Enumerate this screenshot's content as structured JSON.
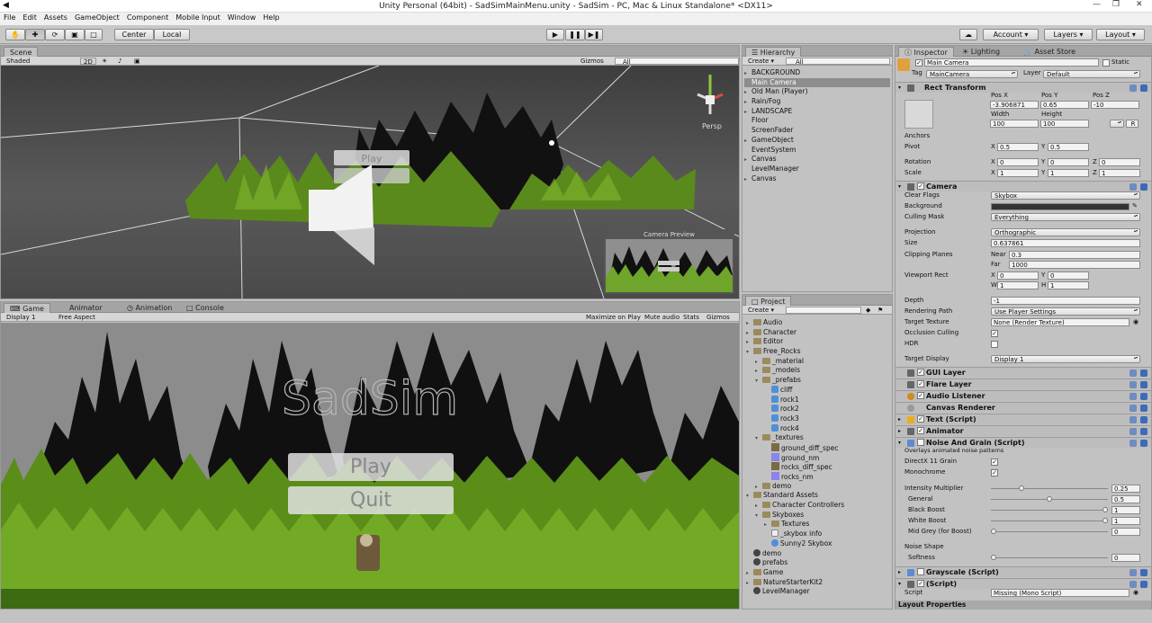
{
  "window": {
    "title": "Unity Personal (64bit) - SadSimMainMenu.unity - SadSim - PC, Mac & Linux Standalone* <DX11>"
  },
  "menu": [
    "File",
    "Edit",
    "Assets",
    "GameObject",
    "Component",
    "Mobile Input",
    "Window",
    "Help"
  ],
  "toolbar": {
    "pivot": "Center",
    "space": "Local",
    "cloud": "",
    "account": "Account",
    "layers": "Layers",
    "layout": "Layout"
  },
  "scene": {
    "tab": "Scene",
    "shading": "Shaded",
    "mode2d": "2D",
    "gizmos": "Gizmos",
    "search": "All",
    "persp": "Persp",
    "preview": "Camera Preview",
    "play_text": "Play"
  },
  "game": {
    "tabs": [
      "Game",
      "Animator",
      "Animation",
      "Console"
    ],
    "display": "Display 1",
    "aspect": "Free Aspect",
    "buttons": [
      "Maximize on Play",
      "Mute audio",
      "Stats",
      "Gizmos"
    ],
    "logo": "SadSim",
    "play": "Play",
    "quit": "Quit"
  },
  "hierarchy": {
    "tab": "Hierarchy",
    "create": "Create",
    "search": "All",
    "items": [
      {
        "label": "BACKGROUND",
        "arrow": true,
        "sel": false
      },
      {
        "label": "Main Camera",
        "arrow": false,
        "sel": true
      },
      {
        "label": "Old Man (Player)",
        "arrow": true,
        "sel": false
      },
      {
        "label": "Rain/Fog",
        "arrow": true,
        "sel": false
      },
      {
        "label": "LANDSCAPE",
        "arrow": true,
        "sel": false
      },
      {
        "label": "Floor",
        "arrow": false,
        "sel": false
      },
      {
        "label": "ScreenFader",
        "arrow": false,
        "sel": false
      },
      {
        "label": "GameObject",
        "arrow": true,
        "sel": false
      },
      {
        "label": "EventSystem",
        "arrow": false,
        "sel": false
      },
      {
        "label": "Canvas",
        "arrow": true,
        "sel": false
      },
      {
        "label": "LevelManager",
        "arrow": false,
        "sel": false
      },
      {
        "label": "Canvas",
        "arrow": true,
        "sel": false
      }
    ]
  },
  "project": {
    "tab": "Project",
    "create": "Create",
    "items": [
      {
        "label": "Audio",
        "indent": 0,
        "icon": "folder",
        "arrow": "▸"
      },
      {
        "label": "Character",
        "indent": 0,
        "icon": "folder",
        "arrow": "▸"
      },
      {
        "label": "Editor",
        "indent": 0,
        "icon": "folder",
        "arrow": "▸"
      },
      {
        "label": "Free_Rocks",
        "indent": 0,
        "icon": "folder",
        "arrow": "▾"
      },
      {
        "label": "_material",
        "indent": 1,
        "icon": "folder",
        "arrow": "▸"
      },
      {
        "label": "_models",
        "indent": 1,
        "icon": "folder",
        "arrow": "▸"
      },
      {
        "label": "_prefabs",
        "indent": 1,
        "icon": "folder",
        "arrow": "▾"
      },
      {
        "label": "cliff",
        "indent": 2,
        "icon": "cube",
        "arrow": ""
      },
      {
        "label": "rock1",
        "indent": 2,
        "icon": "cube",
        "arrow": ""
      },
      {
        "label": "rock2",
        "indent": 2,
        "icon": "cube",
        "arrow": ""
      },
      {
        "label": "rock3",
        "indent": 2,
        "icon": "cube",
        "arrow": ""
      },
      {
        "label": "rock4",
        "indent": 2,
        "icon": "cube",
        "arrow": ""
      },
      {
        "label": "_textures",
        "indent": 1,
        "icon": "folder",
        "arrow": "▾"
      },
      {
        "label": "ground_diff_spec",
        "indent": 2,
        "icon": "tex",
        "arrow": ""
      },
      {
        "label": "ground_nm",
        "indent": 2,
        "icon": "texb",
        "arrow": ""
      },
      {
        "label": "rocks_diff_spec",
        "indent": 2,
        "icon": "tex",
        "arrow": ""
      },
      {
        "label": "rocks_nm",
        "indent": 2,
        "icon": "texb",
        "arrow": ""
      },
      {
        "label": "demo",
        "indent": 1,
        "icon": "folder",
        "arrow": "▸"
      },
      {
        "label": "Standard Assets",
        "indent": 0,
        "icon": "folder",
        "arrow": "▾"
      },
      {
        "label": "Character Controllers",
        "indent": 1,
        "icon": "folder",
        "arrow": "▸"
      },
      {
        "label": "Skyboxes",
        "indent": 1,
        "icon": "folder",
        "arrow": "▾"
      },
      {
        "label": "Textures",
        "indent": 2,
        "icon": "folder",
        "arrow": "▸"
      },
      {
        "label": "_skybox info",
        "indent": 2,
        "icon": "doc",
        "arrow": ""
      },
      {
        "label": "Sunny2 Skybox",
        "indent": 2,
        "icon": "sphere",
        "arrow": ""
      },
      {
        "label": "demo",
        "indent": 0,
        "icon": "unity",
        "arrow": ""
      },
      {
        "label": "prefabs",
        "indent": 0,
        "icon": "unity",
        "arrow": ""
      },
      {
        "label": "Game",
        "indent": 0,
        "icon": "folder",
        "arrow": "▸"
      },
      {
        "label": "NatureStarterKit2",
        "indent": 0,
        "icon": "folder",
        "arrow": "▸"
      },
      {
        "label": "LevelManager",
        "indent": 0,
        "icon": "unity",
        "arrow": ""
      }
    ]
  },
  "inspector": {
    "tabs": [
      "Inspector",
      "Lighting",
      "Asset Store"
    ],
    "name": "Main Camera",
    "static": "Static",
    "tag_label": "Tag",
    "tag": "MainCamera",
    "layer_label": "Layer",
    "layer": "Default",
    "rect": {
      "title": "Rect Transform",
      "posx_l": "Pos X",
      "posy_l": "Pos Y",
      "posz_l": "Pos Z",
      "posx": "-3.906871",
      "posy": "0.65",
      "posz": "-10",
      "w_l": "Width",
      "h_l": "Height",
      "w": "100",
      "h": "100",
      "anchors": "Anchors",
      "pivot": "Pivot",
      "px": "0.5",
      "py": "0.5",
      "rotation": "Rotation",
      "rx": "0",
      "ry": "0",
      "rz": "0",
      "scale": "Scale",
      "sx": "1",
      "sy": "1",
      "sz": "1",
      "r": "R"
    },
    "camera": {
      "title": "Camera",
      "clear_l": "Clear Flags",
      "clear": "Skybox",
      "bg_l": "Background",
      "cull_l": "Culling Mask",
      "cull": "Everything",
      "proj_l": "Projection",
      "proj": "Orthographic",
      "size_l": "Size",
      "size": "0.637861",
      "clip_l": "Clipping Planes",
      "near_l": "Near",
      "near": "0.3",
      "far_l": "Far",
      "far": "1000",
      "vp_l": "Viewport Rect",
      "vx": "0",
      "vy": "0",
      "vw": "1",
      "vh": "1",
      "depth_l": "Depth",
      "depth": "-1",
      "rp_l": "Rendering Path",
      "rp": "Use Player Settings",
      "tt_l": "Target Texture",
      "tt": "None (Render Texture)",
      "oc_l": "Occlusion Culling",
      "hdr_l": "HDR",
      "td_l": "Target Display",
      "td": "Display 1"
    },
    "components": [
      "GUI Layer",
      "Flare Layer",
      "Audio Listener",
      "Canvas Renderer",
      "Text (Script)",
      "Animator"
    ],
    "noise": {
      "title": "Noise And Grain (Script)",
      "desc": "Overlays animated noise patterns",
      "dx_l": "DirectX 11 Grain",
      "mono_l": "Monochrome",
      "im_l": "Intensity Multiplier",
      "im": "0.25",
      "im_v": 0.25,
      "gen_l": "General",
      "gen": "0.5",
      "gen_v": 0.5,
      "bb_l": "Black Boost",
      "bb": "1",
      "bb_v": 1,
      "wb_l": "White Boost",
      "wb": "1",
      "wb_v": 1,
      "mg_l": "Mid Grey (for Boost)",
      "mg": "0",
      "mg_v": 0,
      "ns_l": "Noise Shape",
      "soft_l": "Softness",
      "soft": "0",
      "soft_v": 0
    },
    "gray": {
      "title": "Grayscale (Script)"
    },
    "missing": {
      "title": "(Script)",
      "script_l": "Script",
      "script": "Missing (Mono Script)"
    },
    "layout_props": "Layout Properties"
  }
}
